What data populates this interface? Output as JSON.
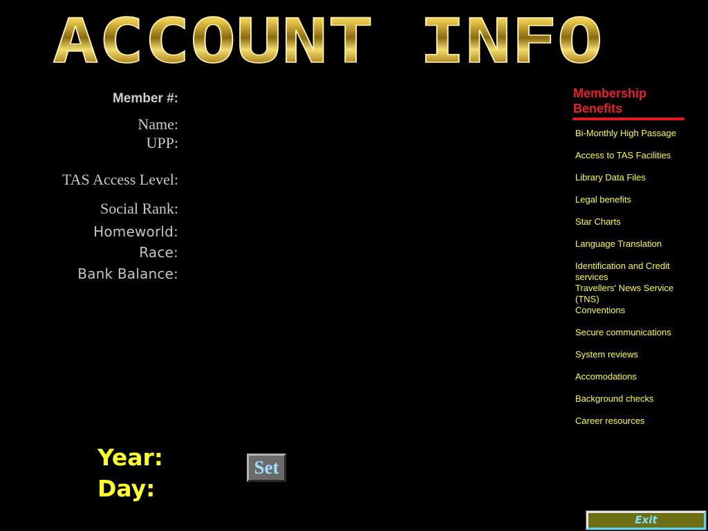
{
  "header": {
    "title": "ACCOUNT INFO"
  },
  "account": {
    "member_label": "Member #:",
    "name_label": "Name:",
    "upp_label": "UPP:",
    "tas_label": "TAS Access Level:",
    "social_label": "Social Rank:",
    "homeworld_label": "Homeworld:",
    "race_label": "Race:",
    "bank_label": "Bank Balance:"
  },
  "date": {
    "year_label": "Year:",
    "day_label": "Day:",
    "set_label": "Set"
  },
  "benefits": {
    "title_line1": "Membership",
    "title_line2": "Benefits",
    "items": [
      "Bi-Monthly High Passage",
      "Access to TAS Facilities",
      "Library Data Files",
      "Legal benefits",
      "Star Charts",
      "Language Translation",
      "Identification and Credit services",
      "Travellers' News Service (TNS)",
      "Conventions",
      "Secure communications",
      "System reviews",
      "Accomodations",
      "Background checks",
      "Career resources"
    ]
  },
  "footer": {
    "exit_label": "Exit"
  },
  "colors": {
    "background": "#000000",
    "gold": "#d8b840",
    "benefit_text": "#ffff33",
    "benefit_heading": "#e8202a",
    "date_text": "#ffff2a",
    "button_text": "#9fdfff"
  }
}
